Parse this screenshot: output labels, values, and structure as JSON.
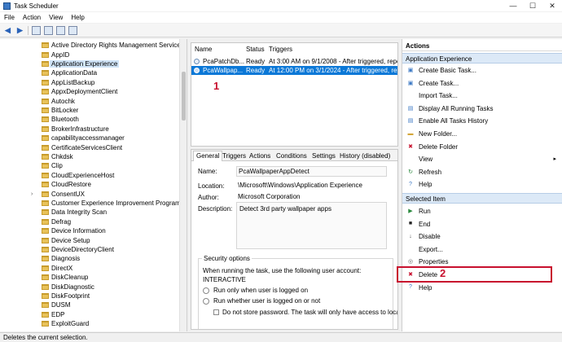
{
  "window": {
    "title": "Task Scheduler"
  },
  "menu": [
    "File",
    "Action",
    "View",
    "Help"
  ],
  "tree": {
    "items": [
      {
        "label": "Active Directory Rights Management Services C",
        "expandable": false
      },
      {
        "label": "AppID",
        "expandable": false
      },
      {
        "label": "Application Experience",
        "expandable": false,
        "selected": true
      },
      {
        "label": "ApplicationData",
        "expandable": false
      },
      {
        "label": "AppListBackup",
        "expandable": false
      },
      {
        "label": "AppxDeploymentClient",
        "expandable": false
      },
      {
        "label": "Autochk",
        "expandable": false
      },
      {
        "label": "BitLocker",
        "expandable": false
      },
      {
        "label": "Bluetooth",
        "expandable": false
      },
      {
        "label": "BrokerInfrastructure",
        "expandable": false
      },
      {
        "label": "capabilityaccessmanager",
        "expandable": false
      },
      {
        "label": "CertificateServicesClient",
        "expandable": false
      },
      {
        "label": "Chkdsk",
        "expandable": false
      },
      {
        "label": "Clip",
        "expandable": false
      },
      {
        "label": "CloudExperienceHost",
        "expandable": false
      },
      {
        "label": "CloudRestore",
        "expandable": false
      },
      {
        "label": "ConsentUX",
        "expandable": true
      },
      {
        "label": "Customer Experience Improvement Program",
        "expandable": false
      },
      {
        "label": "Data Integrity Scan",
        "expandable": false
      },
      {
        "label": "Defrag",
        "expandable": false
      },
      {
        "label": "Device Information",
        "expandable": false
      },
      {
        "label": "Device Setup",
        "expandable": false
      },
      {
        "label": "DeviceDirectoryClient",
        "expandable": false
      },
      {
        "label": "Diagnosis",
        "expandable": false
      },
      {
        "label": "DirectX",
        "expandable": false
      },
      {
        "label": "DiskCleanup",
        "expandable": false
      },
      {
        "label": "DiskDiagnostic",
        "expandable": false
      },
      {
        "label": "DiskFootprint",
        "expandable": false
      },
      {
        "label": "DUSM",
        "expandable": false
      },
      {
        "label": "EDP",
        "expandable": false
      },
      {
        "label": "ExploitGuard",
        "expandable": false
      }
    ]
  },
  "tasklist": {
    "columns": [
      "Name",
      "Status",
      "Triggers"
    ],
    "rows": [
      {
        "name": "PcaPatchDb...",
        "status": "Ready",
        "triggers": "At 3:00 AM on 9/1/2008 - After triggered, repeat",
        "selected": false
      },
      {
        "name": "PcaWallpap...",
        "status": "Ready",
        "triggers": "At 12:00 PM on 3/1/2024 - After triggered, repea",
        "selected": true
      }
    ]
  },
  "annotations": {
    "one": "1",
    "two": "2"
  },
  "detail": {
    "tabs": [
      "General",
      "Triggers",
      "Actions",
      "Conditions",
      "Settings",
      "History (disabled)"
    ],
    "name_label": "Name:",
    "name_value": "PcaWallpaperAppDetect",
    "location_label": "Location:",
    "location_value": "\\Microsoft\\Windows\\Application Experience",
    "author_label": "Author:",
    "author_value": "Microsoft Corporation",
    "description_label": "Description:",
    "description_value": "Detect 3rd party wallpaper apps",
    "security": {
      "legend": "Security options",
      "prompt": "When running the task, use the following user account:",
      "account": "INTERACTIVE",
      "radio1": "Run only when user is logged on",
      "radio2": "Run whether user is logged on or not",
      "checkbox": "Do not store password.  The task will only have access to loca"
    }
  },
  "actions": {
    "title": "Actions",
    "section1": "Application Experience",
    "section1_items": [
      {
        "label": "Create Basic Task...",
        "icon": "create-basic-task-icon",
        "submenu": false
      },
      {
        "label": "Create Task...",
        "icon": "create-task-icon",
        "submenu": false
      },
      {
        "label": "Import Task...",
        "icon": "",
        "submenu": false
      },
      {
        "label": "Display All Running Tasks",
        "icon": "running-tasks-icon",
        "submenu": false
      },
      {
        "label": "Enable All Tasks History",
        "icon": "history-icon",
        "submenu": false
      },
      {
        "label": "New Folder...",
        "icon": "new-folder-icon",
        "submenu": false
      },
      {
        "label": "Delete Folder",
        "icon": "delete-folder-icon",
        "submenu": false
      },
      {
        "label": "View",
        "icon": "",
        "submenu": true
      },
      {
        "label": "Refresh",
        "icon": "refresh-icon",
        "submenu": false
      },
      {
        "label": "Help",
        "icon": "help-icon",
        "submenu": false
      }
    ],
    "section2": "Selected Item",
    "section2_items": [
      {
        "label": "Run",
        "icon": "run-icon",
        "submenu": false
      },
      {
        "label": "End",
        "icon": "end-icon",
        "submenu": false
      },
      {
        "label": "Disable",
        "icon": "disable-icon",
        "submenu": false
      },
      {
        "label": "Export...",
        "icon": "",
        "submenu": false
      },
      {
        "label": "Properties",
        "icon": "properties-icon",
        "submenu": false
      },
      {
        "label": "Delete",
        "icon": "delete-icon",
        "submenu": false
      },
      {
        "label": "Help",
        "icon": "help-icon",
        "submenu": false
      }
    ]
  },
  "status": {
    "text": "Deletes the current selection."
  },
  "colors": {
    "selection": "#0b78d7",
    "section_bg": "#dce9f7",
    "annotation": "#c8102e"
  }
}
